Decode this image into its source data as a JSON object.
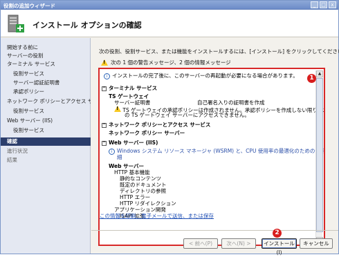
{
  "window": {
    "title": "役割の追加ウィザード",
    "controls": [
      "_",
      "□",
      "x"
    ]
  },
  "header": {
    "title": "インストール オプションの確認",
    "icon": "server-add-icon"
  },
  "nav": {
    "items": [
      {
        "label": "開始する前に",
        "state": "done"
      },
      {
        "label": "サーバーの役割",
        "state": "done"
      },
      {
        "label": "ターミナル サービス",
        "state": "done"
      },
      {
        "label": "役割サービス",
        "state": "done",
        "indent": 1
      },
      {
        "label": "サーバー認証証明書",
        "state": "done",
        "indent": 1
      },
      {
        "label": "承認ポリシー",
        "state": "done",
        "indent": 1
      },
      {
        "label": "ネットワーク ポリシーとアクセス サービ...",
        "state": "done"
      },
      {
        "label": "役割サービス",
        "state": "done",
        "indent": 1
      },
      {
        "label": "Web サーバー (IIS)",
        "state": "done"
      },
      {
        "label": "役割サービス",
        "state": "done",
        "indent": 1
      },
      {
        "label": "確認",
        "state": "active"
      },
      {
        "label": "進行状況",
        "state": "inactive"
      },
      {
        "label": "結果",
        "state": "inactive"
      }
    ]
  },
  "content": {
    "intro": "次の役割、役割サービス、または機能をインストールするには、[インストール] をクリックしてください。",
    "warning_summary": "次の 1 個の警告メッセージ、2 個の情報メッセージ",
    "info_restart": "インストールの完了後に、このサーバーの再起動が必要になる場合があります。",
    "sections": {
      "ts_header": "ターミナル サービス",
      "ts_gateway": "TS ゲートウェイ",
      "server_cert_label": "サーバー証明書",
      "server_cert_value": "自己署名入りの証明書を作成",
      "ts_warning_1": "TS ゲートウェイの承認ポリシーは作成されません。承認ポリシーを作成しない限り、ユーザーはこ",
      "ts_warning_2": "の TS ゲートウェイ サーバーにアクセスできません。",
      "npas_header": "ネットワーク ポリシーとアクセス サービス",
      "npas_server": "ネットワーク ポリシー サーバー",
      "iis_header": "Web サーバー (IIS)",
      "iis_info_1": "Windows システム リソース マネージャ (WSRM) と、CPU 使用率の最適化のための活用方法の詳",
      "iis_info_2": "細",
      "web_server": "Web サーバー",
      "http_common": "HTTP 基本機能",
      "static_content": "静的なコンテンツ",
      "default_document": "既定のドキュメント",
      "dir_browsing": "ディレクトリの参照",
      "http_errors": "HTTP エラー",
      "http_redirect": "HTTP リダイレクション",
      "app_dev": "アプリケーション開発",
      "isapi": "ISAPI 拡張"
    },
    "link": "この情報を印刷、電子メールで送信、または保存",
    "callout_1": "1",
    "callout_2": "2"
  },
  "buttons": {
    "back": "< 前へ(P)",
    "next": "次へ(N) >",
    "install": "インストール(I)",
    "cancel": "キャンセル"
  },
  "colors": {
    "callout": "#d81e1e",
    "nav_active_bg": "#2b3d6b",
    "link": "#1f4fb4"
  }
}
